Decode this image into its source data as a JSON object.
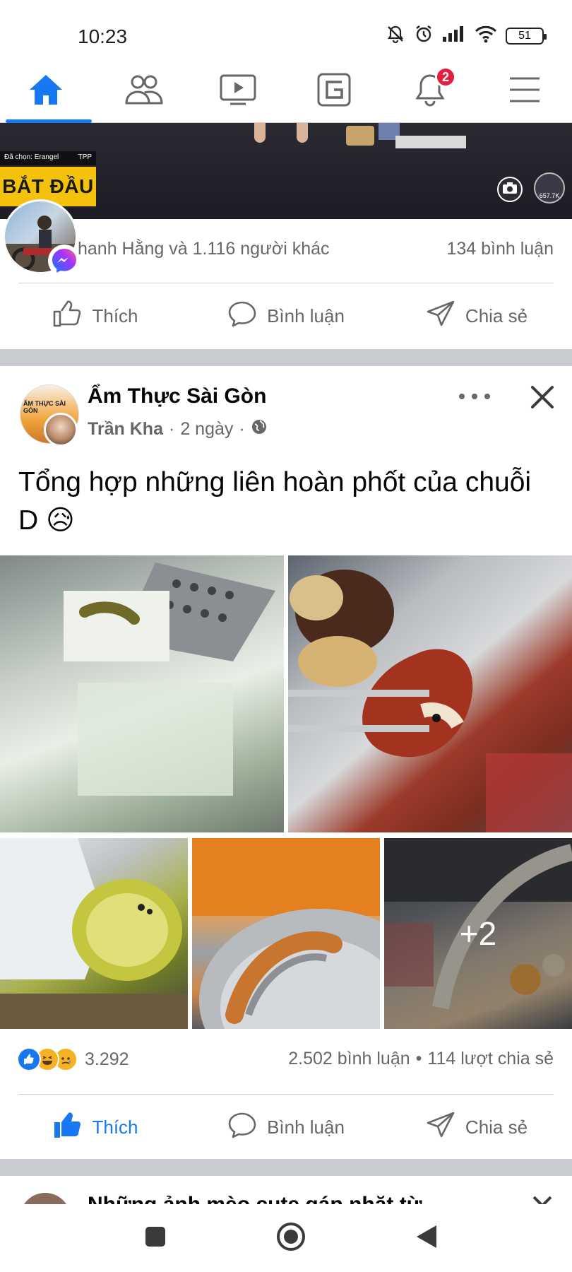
{
  "status_bar": {
    "time": "10:23",
    "battery": "51"
  },
  "top_nav": {
    "items": [
      {
        "icon": "home-icon",
        "active": true
      },
      {
        "icon": "friends-icon",
        "active": false
      },
      {
        "icon": "watch-icon",
        "active": false
      },
      {
        "icon": "gaming-icon",
        "active": false
      },
      {
        "icon": "notifications-icon",
        "active": false,
        "badge": "2"
      },
      {
        "icon": "menu-icon",
        "active": false
      }
    ],
    "accent": "#1877f2"
  },
  "previous_post": {
    "game_tag": "Đã chọn: Erangel",
    "game_tag_right": "TPP",
    "game_banner": "BẮT ĐẦU",
    "viewer_count": "657.7K",
    "likes_text": "hanh Hằng và 1.116 người khác",
    "comments_text": "134 bình luận",
    "actions": {
      "like": "Thích",
      "comment": "Bình luận",
      "share": "Chia sẻ"
    }
  },
  "post": {
    "page_name": "Ẩm Thực Sài Gòn",
    "avatar_text": "ẨM THỰC SÀI GÒN",
    "author": "Trần Kha",
    "time": "2 ngày",
    "text": "Tổng hợp những liên hoàn phốt của chuỗi D 😥",
    "photos_more": "+2",
    "reaction_count": "3.292",
    "comments": "2.502 bình luận",
    "separator": "•",
    "shares": "114 lượt chia sẻ",
    "actions": {
      "like": "Thích",
      "comment": "Bình luận",
      "share": "Chia sẻ"
    },
    "liked": true
  },
  "next_post": {
    "title": "Những ảnh mèo cute gáp nhặt từ..."
  },
  "android_nav": {
    "buttons": [
      "recents-icon",
      "home-circle-icon",
      "back-icon"
    ]
  }
}
